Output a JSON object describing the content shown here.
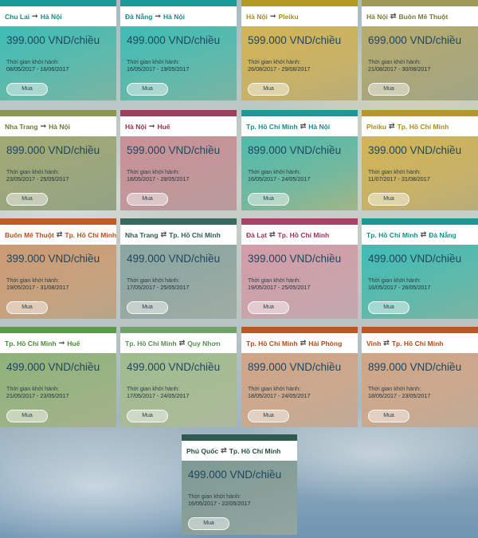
{
  "common": {
    "time_label": "Thời gian khởi hành:",
    "buy_label": "Mua"
  },
  "cards": [
    {
      "from": "Chu Lai",
      "to": "Hà Nội",
      "sep": "one-way",
      "price": "399.000 VND/chiều",
      "dates": "08/05/2017 - 16/06/2017",
      "theme": "teal"
    },
    {
      "from": "Đà Nẵng",
      "to": "Hà Nội",
      "sep": "one-way",
      "price": "499.000 VND/chiều",
      "dates": "16/05/2017 - 19/05/2017",
      "theme": "teal"
    },
    {
      "from": "Hà Nội",
      "to": "Pleiku",
      "sep": "one-way",
      "price": "599.000 VND/chiều",
      "dates": "26/08/2017 - 29/08/2017",
      "theme": "mustard"
    },
    {
      "from": "Hà Nội",
      "to": "Buôn Mê Thuột",
      "sep": "round-trip",
      "price": "699.000 VND/chiều",
      "dates": "21/08/2017 - 30/08/2017",
      "theme": "khaki"
    },
    {
      "from": "Nha Trang",
      "to": "Hà Nội",
      "sep": "one-way",
      "price": "899.000 VND/chiều",
      "dates": "23/05/2017 - 25/05/2017",
      "theme": "olive"
    },
    {
      "from": "Hà Nội",
      "to": "Huế",
      "sep": "one-way",
      "price": "599.000 VND/chiều",
      "dates": "18/05/2017 - 28/05/2017",
      "theme": "rose"
    },
    {
      "from": "Tp. Hồ Chí Minh",
      "to": "Hà Nội",
      "sep": "round-trip",
      "price": "899.000 VND/chiều",
      "dates": "16/05/2017 - 24/05/2017",
      "theme": "tealgold"
    },
    {
      "from": "Pleiku",
      "to": "Tp. Hồ Chí Minh",
      "sep": "round-trip",
      "price": "399.000 VND/chiều",
      "dates": "11/07/2017 - 31/08/2017",
      "theme": "mustard"
    },
    {
      "from": "Buôn Mê Thuột",
      "to": "Tp. Hồ Chí Minh",
      "sep": "round-trip",
      "price": "399.000 VND/chiều",
      "dates": "19/05/2017 - 31/08/2017",
      "theme": "orange"
    },
    {
      "from": "Nha Trang",
      "to": "Tp. Hồ Chí Minh",
      "sep": "round-trip",
      "price": "499.000 VND/chiều",
      "dates": "17/05/2017 - 25/05/2017",
      "theme": "slate"
    },
    {
      "from": "Đà Lạt",
      "to": "Tp. Hồ Chí Minh",
      "sep": "round-trip",
      "price": "399.000 VND/chiều",
      "dates": "19/05/2017 - 25/05/2017",
      "theme": "pink"
    },
    {
      "from": "Tp. Hồ Chí Minh",
      "to": "Đà Nẵng",
      "sep": "round-trip",
      "price": "499.000 VND/chiều",
      "dates": "16/05/2017 - 26/05/2017",
      "theme": "teal"
    },
    {
      "from": "Tp. Hồ Chí Minh",
      "to": "Huế",
      "sep": "one-way",
      "price": "499.000 VND/chiều",
      "dates": "21/05/2017 - 23/05/2017",
      "theme": "green"
    },
    {
      "from": "Tp. Hồ Chí Minh",
      "to": "Quy Nhơn",
      "sep": "round-trip",
      "price": "499.000 VND/chiều",
      "dates": "17/05/2017 - 24/05/2017",
      "theme": "sage"
    },
    {
      "from": "Tp. Hồ Chí Minh",
      "to": "Hải Phòng",
      "sep": "round-trip",
      "price": "899.000 VND/chiều",
      "dates": "18/05/2017 - 24/05/2017",
      "theme": "peach"
    },
    {
      "from": "Vinh",
      "to": "Tp. Hồ Chí Minh",
      "sep": "round-trip",
      "price": "899.000 VND/chiều",
      "dates": "18/05/2017 - 23/05/2017",
      "theme": "peach"
    },
    {
      "from": "Phú Quốc",
      "to": "Tp. Hồ Chí Minh",
      "sep": "round-trip",
      "price": "499.000 VND/chiều",
      "dates": "16/05/2017 - 22/05/2017",
      "theme": "dslate"
    }
  ]
}
